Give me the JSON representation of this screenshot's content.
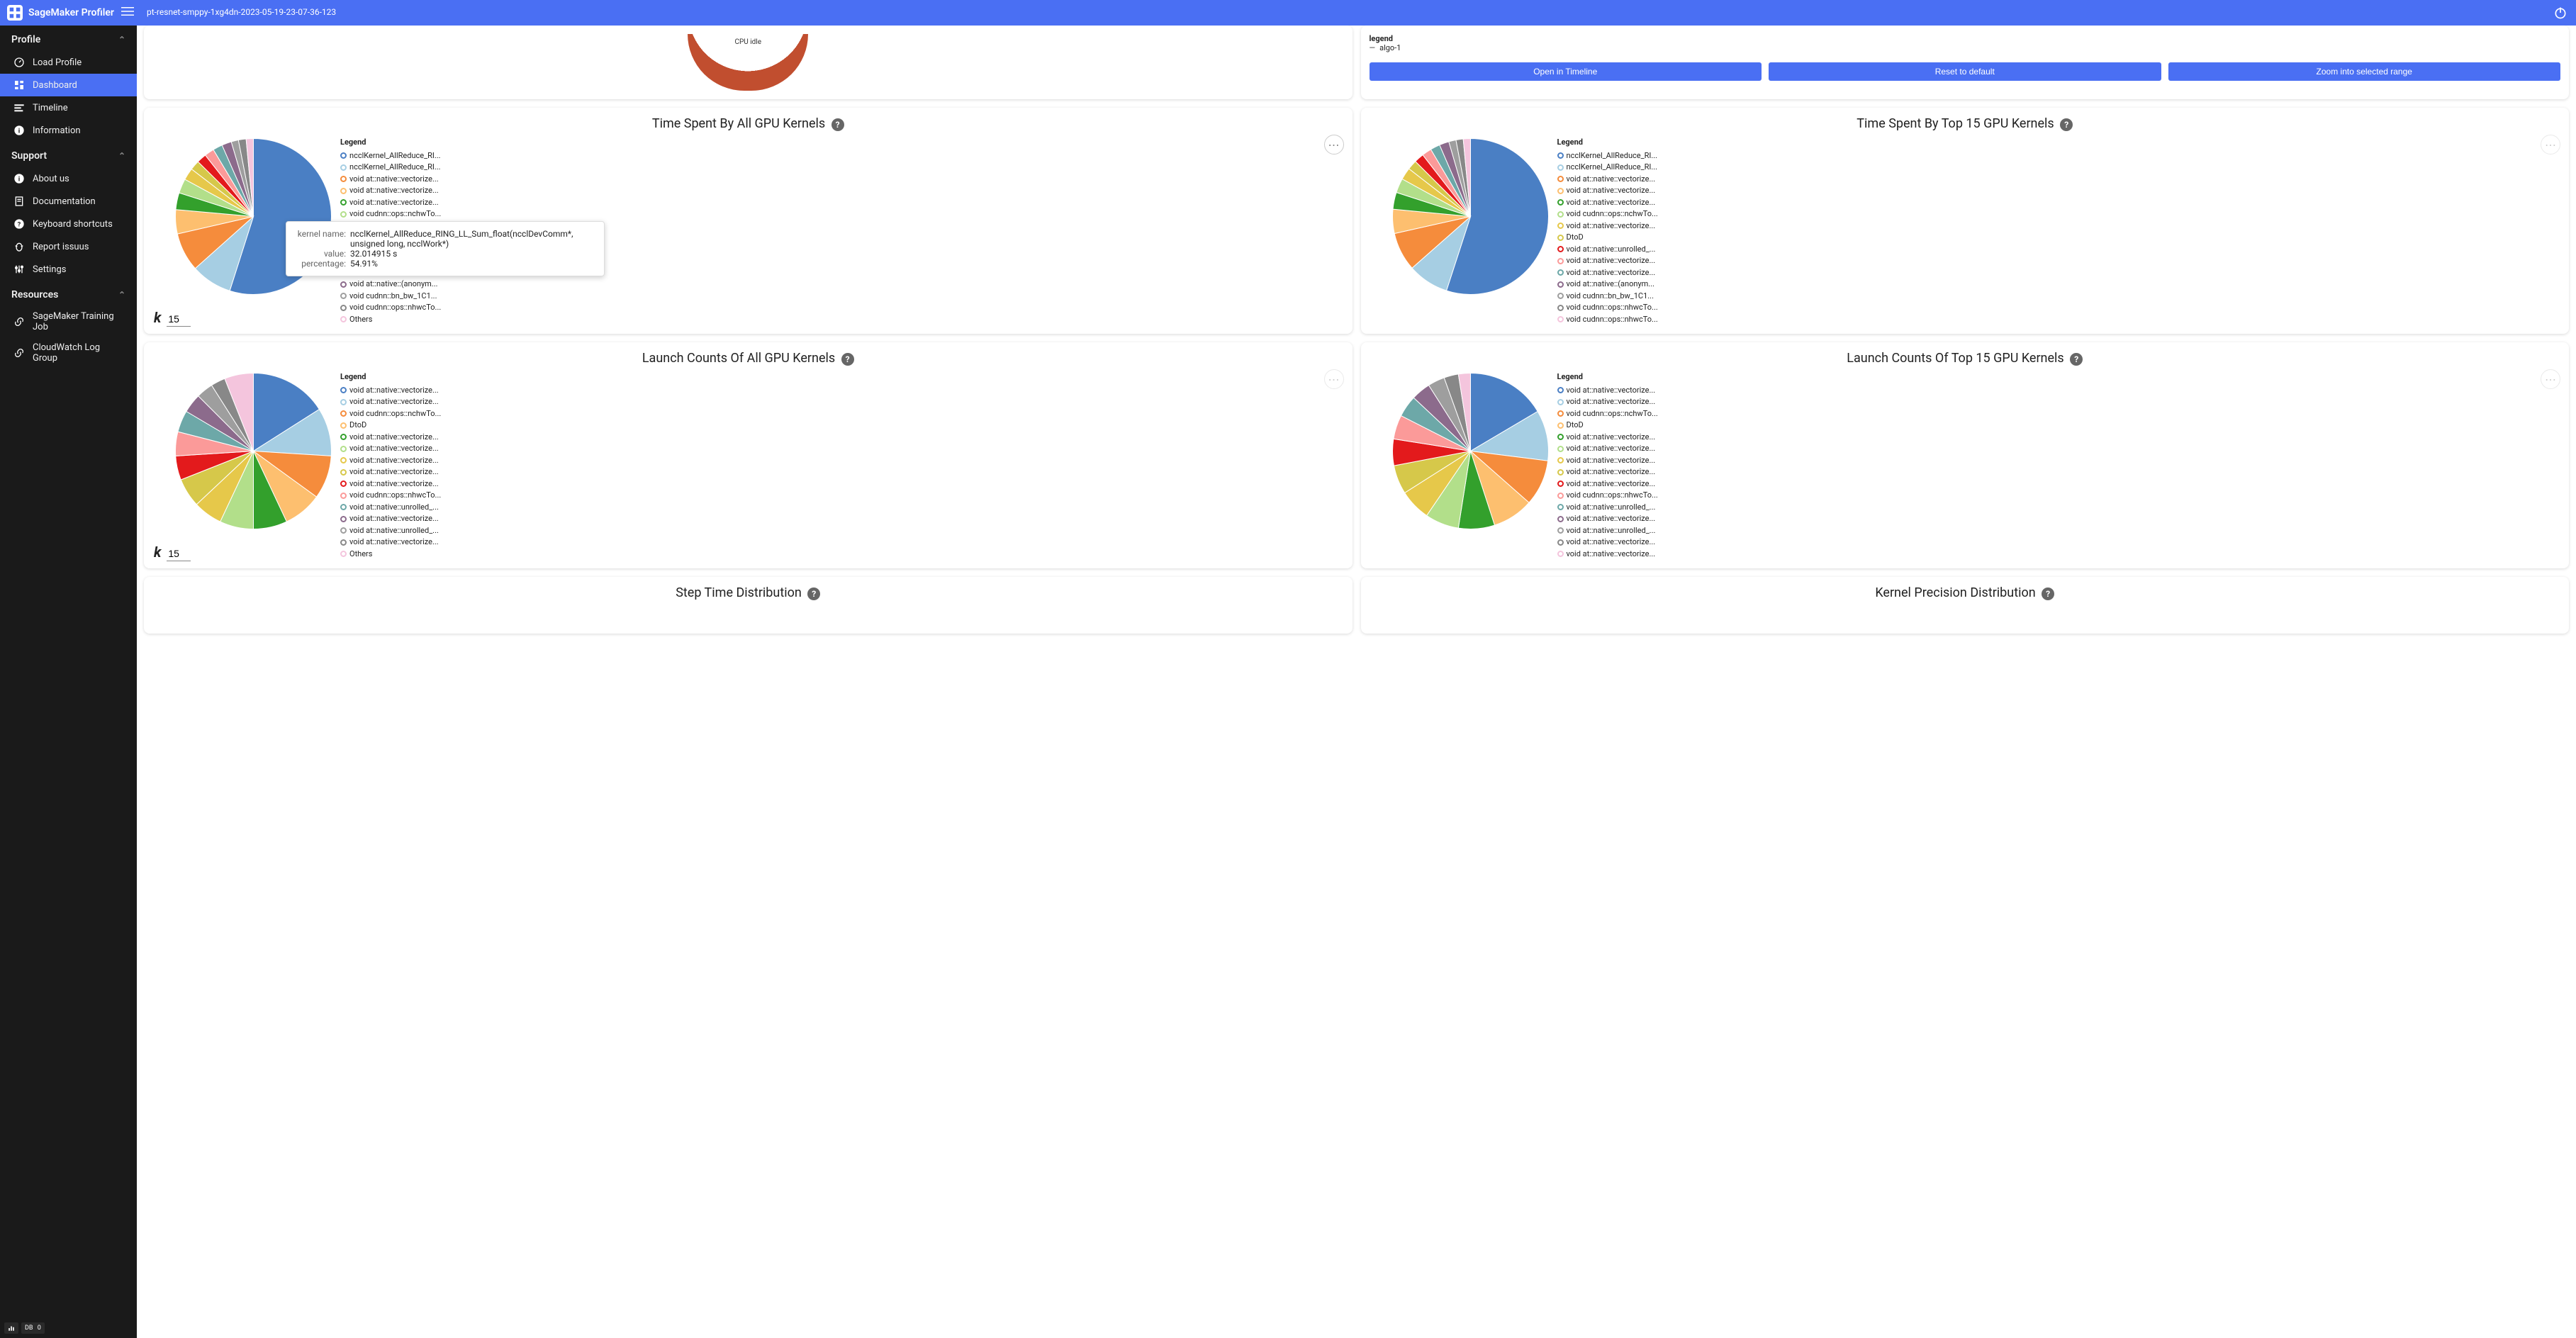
{
  "app": {
    "brand": "SageMaker Profiler",
    "job_name": "pt-resnet-smppy-1xg4dn-2023-05-19-23-07-36-123"
  },
  "sidebar": {
    "sections": {
      "profile": {
        "title": "Profile",
        "items": [
          "Load Profile",
          "Dashboard",
          "Timeline",
          "Information"
        ]
      },
      "support": {
        "title": "Support",
        "items": [
          "About us",
          "Documentation",
          "Keyboard shortcuts",
          "Report issuus",
          "Settings"
        ]
      },
      "resources": {
        "title": "Resources",
        "items": [
          "SageMaker Training Job",
          "CloudWatch Log Group"
        ]
      }
    }
  },
  "top_row": {
    "cpu_label": "CPU idle",
    "right_legend_title": "legend",
    "right_legend_item": "algo-1",
    "buttons": [
      "Open in Timeline",
      "Reset to default",
      "Zoom into selected range"
    ]
  },
  "charts": {
    "time_all": {
      "title": "Time Spent By All GPU Kernels",
      "k": "15",
      "legend_title": "Legend",
      "tooltip": {
        "kernel_name_label": "kernel name:",
        "kernel_name": "ncclKernel_AllReduce_RING_LL_Sum_float(ncclDevComm*, unsigned long, ncclWork*)",
        "value_label": "value:",
        "value": "32.014915 s",
        "percentage_label": "percentage:",
        "percentage": "54.91%"
      }
    },
    "time_top15": {
      "title": "Time Spent By Top 15 GPU Kernels",
      "legend_title": "Legend"
    },
    "launch_all": {
      "title": "Launch Counts Of All GPU Kernels",
      "k": "15",
      "legend_title": "Legend"
    },
    "launch_top15": {
      "title": "Launch Counts Of Top 15 GPU Kernels",
      "legend_title": "Legend"
    },
    "step_time": {
      "title": "Step Time Distribution"
    },
    "kernel_precision": {
      "title": "Kernel Precision Distribution"
    }
  },
  "chart_data": [
    {
      "id": "time_all",
      "type": "pie",
      "title": "Time Spent By All GPU Kernels",
      "series": [
        {
          "name": "ncclKernel_AllReduce_RI...",
          "value": 54.91,
          "color": "#4a7fc4"
        },
        {
          "name": "ncclKernel_AllReduce_RI...",
          "value": 8.5,
          "color": "#a6cee3"
        },
        {
          "name": "void at::native::vectorize...",
          "value": 8.0,
          "color": "#f58c3c"
        },
        {
          "name": "void at::native::vectorize...",
          "value": 5.0,
          "color": "#fdbf6f"
        },
        {
          "name": "void at::native::vectorize...",
          "value": 3.5,
          "color": "#33a02c"
        },
        {
          "name": "void cudnn::ops::nchwTo...",
          "value": 3.0,
          "color": "#b2df8a"
        },
        {
          "name": "void at::native::vectorize...",
          "value": 2.5,
          "color": "#e6c84a"
        },
        {
          "name": "DtoD",
          "value": 2.0,
          "color": "#d6c84a"
        },
        {
          "name": "void at::native::unrolled_...",
          "value": 2.0,
          "color": "#e31a1c"
        },
        {
          "name": "void at::native::vectorize...",
          "value": 2.0,
          "color": "#fb9a99"
        },
        {
          "name": "void at::native::vectorize...",
          "value": 2.0,
          "color": "#6da8a8"
        },
        {
          "name": "void at::native::(anonym...",
          "value": 2.0,
          "color": "#8c6b8c"
        },
        {
          "name": "void cudnn::bn_bw_1C1...",
          "value": 1.5,
          "color": "#9e9e9e"
        },
        {
          "name": "void cudnn::ops::nhwcTo...",
          "value": 1.59,
          "color": "#888888"
        },
        {
          "name": "Others",
          "value": 1.5,
          "color": "#f4c5dd"
        }
      ]
    },
    {
      "id": "time_top15",
      "type": "pie",
      "title": "Time Spent By Top 15 GPU Kernels",
      "series": [
        {
          "name": "ncclKernel_AllReduce_RI...",
          "value": 55.0,
          "color": "#4a7fc4"
        },
        {
          "name": "ncclKernel_AllReduce_RI...",
          "value": 8.5,
          "color": "#a6cee3"
        },
        {
          "name": "void at::native::vectorize...",
          "value": 8.0,
          "color": "#f58c3c"
        },
        {
          "name": "void at::native::vectorize...",
          "value": 5.0,
          "color": "#fdbf6f"
        },
        {
          "name": "void at::native::vectorize...",
          "value": 3.5,
          "color": "#33a02c"
        },
        {
          "name": "void cudnn::ops::nchwTo...",
          "value": 3.0,
          "color": "#b2df8a"
        },
        {
          "name": "void at::native::vectorize...",
          "value": 2.5,
          "color": "#e6c84a"
        },
        {
          "name": "DtoD",
          "value": 2.0,
          "color": "#d6c84a"
        },
        {
          "name": "void at::native::unrolled_...",
          "value": 2.0,
          "color": "#e31a1c"
        },
        {
          "name": "void at::native::vectorize...",
          "value": 2.0,
          "color": "#fb9a99"
        },
        {
          "name": "void at::native::vectorize...",
          "value": 2.0,
          "color": "#6da8a8"
        },
        {
          "name": "void at::native::(anonym...",
          "value": 2.0,
          "color": "#8c6b8c"
        },
        {
          "name": "void cudnn::bn_bw_1C1...",
          "value": 1.5,
          "color": "#9e9e9e"
        },
        {
          "name": "void cudnn::ops::nhwcTo...",
          "value": 1.5,
          "color": "#888888"
        },
        {
          "name": "void cudnn::ops::nhwcTo...",
          "value": 1.5,
          "color": "#f4c5dd"
        }
      ]
    },
    {
      "id": "launch_all",
      "type": "pie",
      "title": "Launch Counts Of All GPU Kernels",
      "series": [
        {
          "name": "void at::native::vectorize...",
          "value": 16.0,
          "color": "#4a7fc4"
        },
        {
          "name": "void at::native::vectorize...",
          "value": 10.0,
          "color": "#a6cee3"
        },
        {
          "name": "void cudnn::ops::nchwTo...",
          "value": 9.0,
          "color": "#f58c3c"
        },
        {
          "name": "DtoD",
          "value": 8.0,
          "color": "#fdbf6f"
        },
        {
          "name": "void at::native::vectorize...",
          "value": 7.0,
          "color": "#33a02c"
        },
        {
          "name": "void at::native::vectorize...",
          "value": 7.0,
          "color": "#b2df8a"
        },
        {
          "name": "void at::native::vectorize...",
          "value": 6.0,
          "color": "#e6c84a"
        },
        {
          "name": "void at::native::vectorize...",
          "value": 6.0,
          "color": "#d6c84a"
        },
        {
          "name": "void at::native::vectorize...",
          "value": 5.0,
          "color": "#e31a1c"
        },
        {
          "name": "void cudnn::ops::nhwcTo...",
          "value": 5.0,
          "color": "#fb9a99"
        },
        {
          "name": "void at::native::unrolled_...",
          "value": 4.5,
          "color": "#6da8a8"
        },
        {
          "name": "void at::native::vectorize...",
          "value": 4.0,
          "color": "#8c6b8c"
        },
        {
          "name": "void at::native::unrolled_...",
          "value": 3.5,
          "color": "#9e9e9e"
        },
        {
          "name": "void at::native::vectorize...",
          "value": 3.0,
          "color": "#888888"
        },
        {
          "name": "Others",
          "value": 6.0,
          "color": "#f4c5dd"
        }
      ]
    },
    {
      "id": "launch_top15",
      "type": "pie",
      "title": "Launch Counts Of Top 15 GPU Kernels",
      "series": [
        {
          "name": "void at::native::vectorize...",
          "value": 16.5,
          "color": "#4a7fc4"
        },
        {
          "name": "void at::native::vectorize...",
          "value": 10.5,
          "color": "#a6cee3"
        },
        {
          "name": "void cudnn::ops::nchwTo...",
          "value": 9.5,
          "color": "#f58c3c"
        },
        {
          "name": "DtoD",
          "value": 8.5,
          "color": "#fdbf6f"
        },
        {
          "name": "void at::native::vectorize...",
          "value": 7.5,
          "color": "#33a02c"
        },
        {
          "name": "void at::native::vectorize...",
          "value": 7.0,
          "color": "#b2df8a"
        },
        {
          "name": "void at::native::vectorize...",
          "value": 6.5,
          "color": "#e6c84a"
        },
        {
          "name": "void at::native::vectorize...",
          "value": 6.0,
          "color": "#d6c84a"
        },
        {
          "name": "void at::native::vectorize...",
          "value": 5.5,
          "color": "#e31a1c"
        },
        {
          "name": "void cudnn::ops::nhwcTo...",
          "value": 5.0,
          "color": "#fb9a99"
        },
        {
          "name": "void at::native::unrolled_...",
          "value": 4.5,
          "color": "#6da8a8"
        },
        {
          "name": "void at::native::vectorize...",
          "value": 4.0,
          "color": "#8c6b8c"
        },
        {
          "name": "void at::native::unrolled_...",
          "value": 3.5,
          "color": "#9e9e9e"
        },
        {
          "name": "void at::native::vectorize...",
          "value": 3.0,
          "color": "#888888"
        },
        {
          "name": "void at::native::vectorize...",
          "value": 2.5,
          "color": "#f4c5dd"
        }
      ]
    }
  ],
  "footer": {
    "db_label": "DB",
    "db_value": "0"
  }
}
